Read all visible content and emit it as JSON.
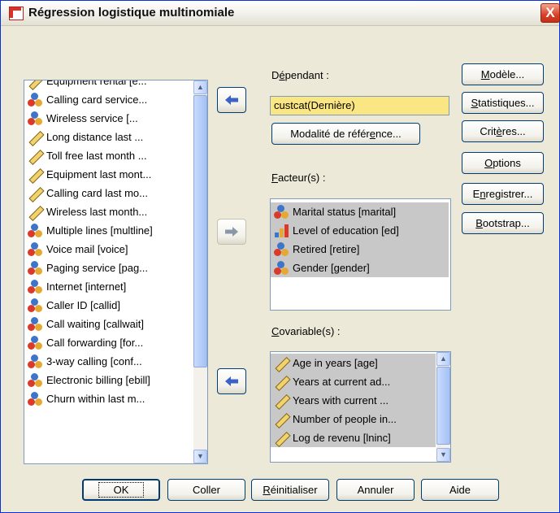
{
  "window": {
    "title": "Régression logistique multinomiale",
    "close_glyph": "X"
  },
  "variables": [
    {
      "label": "Equipment rental [e...",
      "icon": "scale"
    },
    {
      "label": "Calling card service...",
      "icon": "nominal"
    },
    {
      "label": "Wireless service [...",
      "icon": "nominal"
    },
    {
      "label": "Long distance last ...",
      "icon": "scale"
    },
    {
      "label": "Toll free last month ...",
      "icon": "scale"
    },
    {
      "label": "Equipment last mont...",
      "icon": "scale"
    },
    {
      "label": "Calling card last mo...",
      "icon": "scale"
    },
    {
      "label": "Wireless last month...",
      "icon": "scale"
    },
    {
      "label": "Multiple lines [multline]",
      "icon": "nominal"
    },
    {
      "label": "Voice mail [voice]",
      "icon": "nominal"
    },
    {
      "label": "Paging service [pag...",
      "icon": "nominal"
    },
    {
      "label": "Internet [internet]",
      "icon": "nominal"
    },
    {
      "label": "Caller ID [callid]",
      "icon": "nominal"
    },
    {
      "label": "Call waiting [callwait]",
      "icon": "nominal"
    },
    {
      "label": "Call forwarding [for...",
      "icon": "nominal"
    },
    {
      "label": "3-way calling [conf...",
      "icon": "nominal"
    },
    {
      "label": "Electronic billing [ebill]",
      "icon": "nominal"
    },
    {
      "label": "Churn within last m...",
      "icon": "nominal"
    }
  ],
  "dependent": {
    "label_pre": "D",
    "label_u": "é",
    "label_post": "pendant :",
    "value": "custcat(Dernière)",
    "ref_button_pre": "Modalité de référ",
    "ref_button_u": "e",
    "ref_button_post": "nce..."
  },
  "factors": {
    "label_u": "F",
    "label_post": "acteur(s) :",
    "items": [
      {
        "label": "Marital status [marital]",
        "icon": "nominal"
      },
      {
        "label": "Level of education [ed]",
        "icon": "ordinal"
      },
      {
        "label": "Retired [retire]",
        "icon": "nominal"
      },
      {
        "label": "Gender [gender]",
        "icon": "nominal"
      }
    ]
  },
  "covariates": {
    "label_u": "C",
    "label_post": "ovariable(s) :",
    "items": [
      {
        "label": "Age in years [age]",
        "icon": "scale"
      },
      {
        "label": "Years at current ad...",
        "icon": "scale"
      },
      {
        "label": "Years with current ...",
        "icon": "scale"
      },
      {
        "label": "Number of people in...",
        "icon": "scale"
      },
      {
        "label": "Log de revenu [lninc]",
        "icon": "scale"
      }
    ]
  },
  "side_buttons": {
    "model": {
      "pre": "",
      "u": "M",
      "post": "odèle..."
    },
    "statistics": {
      "pre": "",
      "u": "S",
      "post": "tatistiques..."
    },
    "criteria": {
      "pre": "Crit",
      "u": "è",
      "post": "res..."
    },
    "options": {
      "pre": "",
      "u": "O",
      "post": "ptions"
    },
    "save": {
      "pre": "E",
      "u": "n",
      "post": "registrer..."
    },
    "bootstrap": {
      "pre": "",
      "u": "B",
      "post": "ootstrap..."
    }
  },
  "bottom_buttons": {
    "ok": "OK",
    "paste": "Coller",
    "reset_u": "R",
    "reset_post": "éinitialiser",
    "cancel": "Annuler",
    "help": "Aide"
  },
  "colors": {
    "arrow": "#3b63c4",
    "field_highlight": "#fbe684",
    "selected_row": "#c8c8c8"
  }
}
